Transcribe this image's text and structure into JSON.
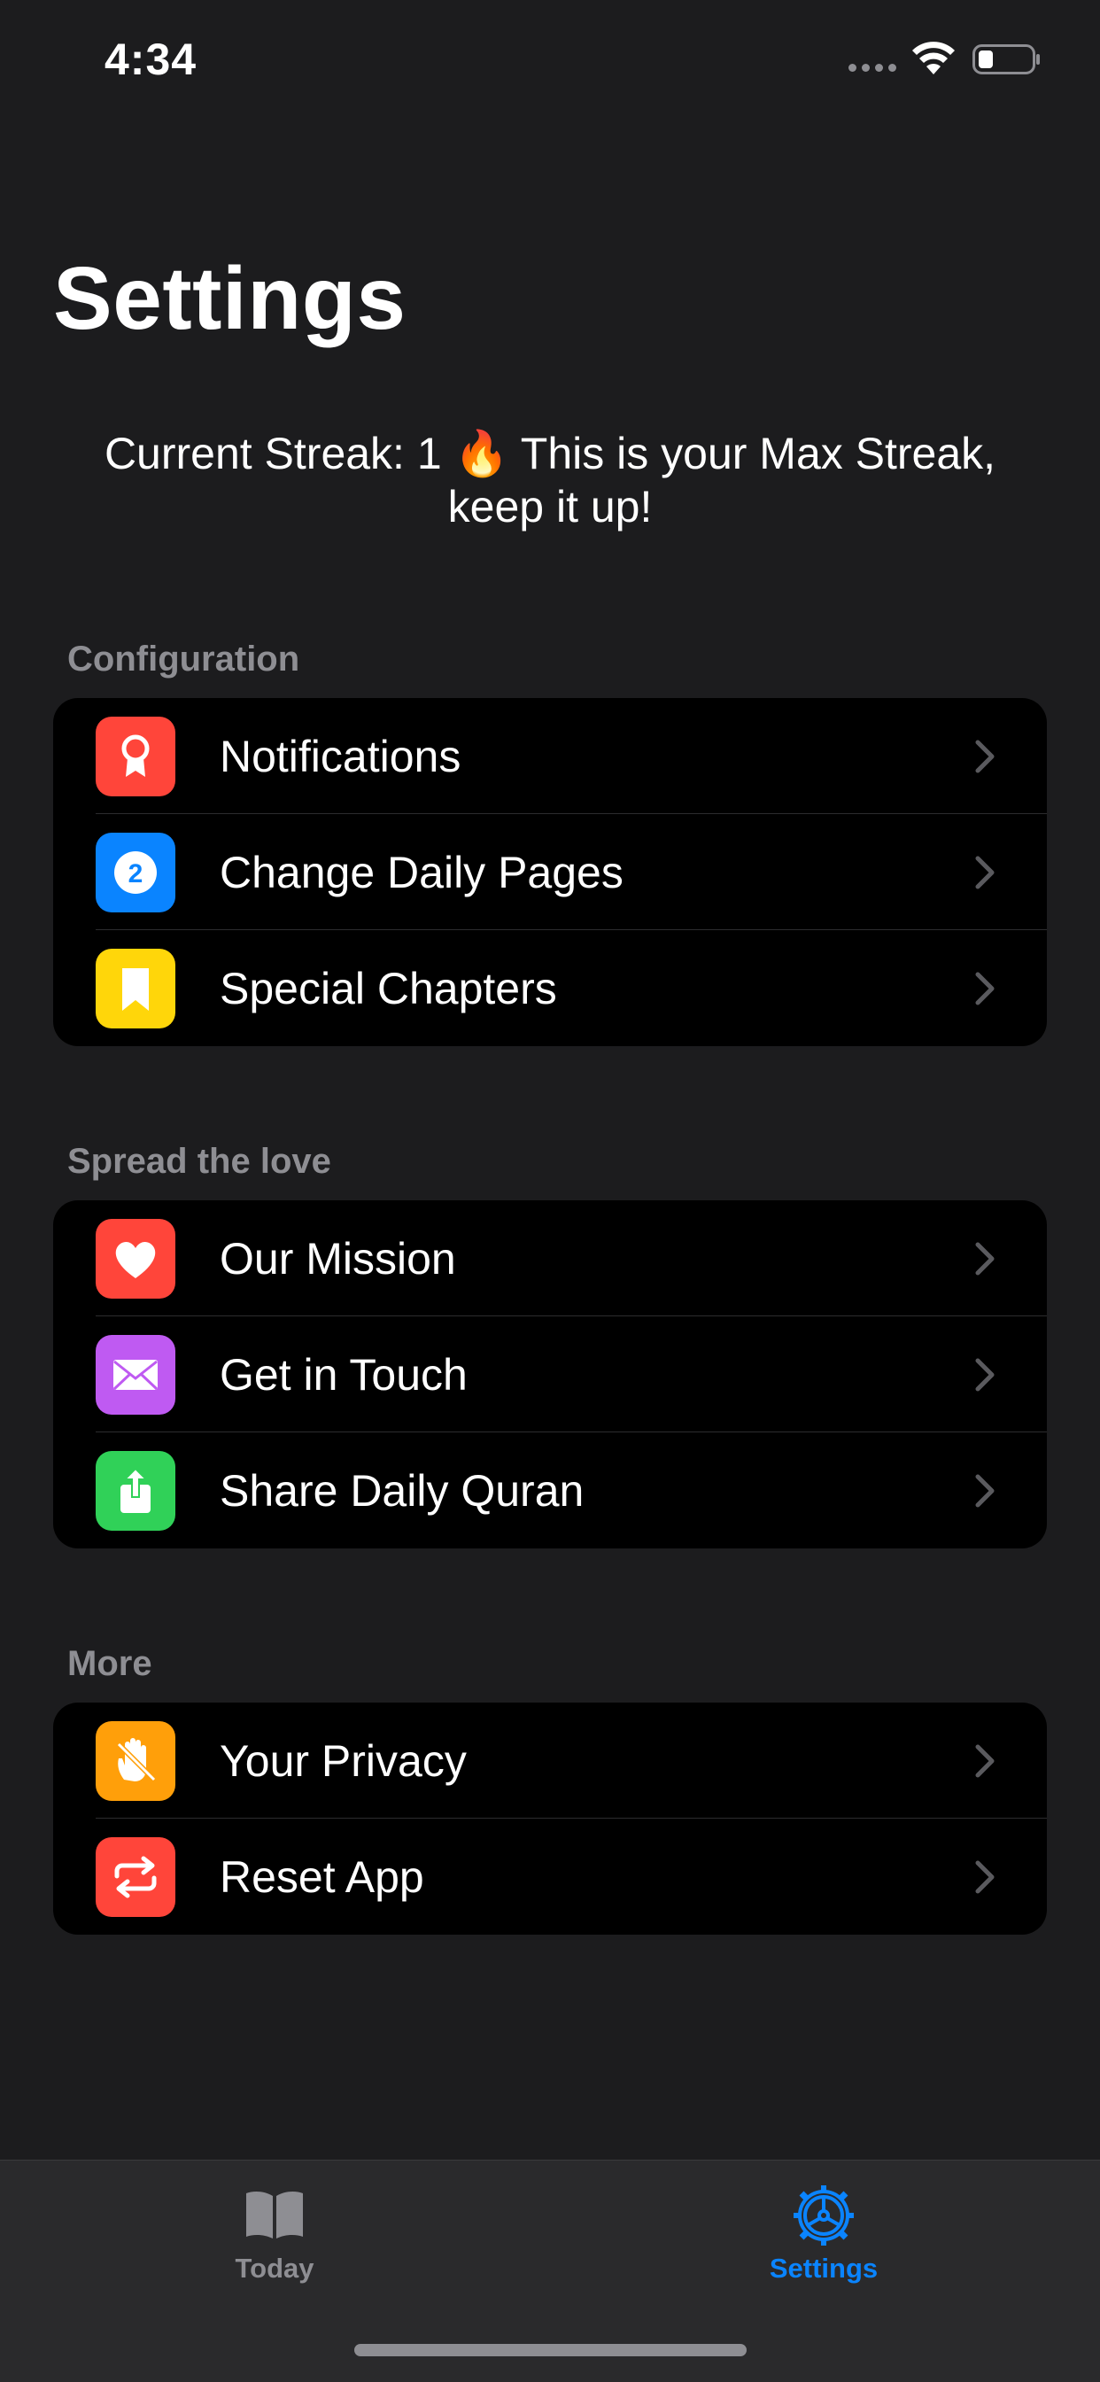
{
  "status_bar": {
    "time": "4:34"
  },
  "title": "Settings",
  "streak": {
    "text": "Current Streak: 1 🔥 This is your Max Streak, keep it up!"
  },
  "sections": [
    {
      "header": "Configuration",
      "items": [
        {
          "label": "Notifications",
          "icon": "ribbon-award-icon",
          "color": "#ff453a"
        },
        {
          "label": "Change Daily Pages",
          "icon": "number-2-circle-icon",
          "color": "#0a84ff"
        },
        {
          "label": "Special Chapters",
          "icon": "bookmark-icon",
          "color": "#ffd60a"
        }
      ]
    },
    {
      "header": "Spread the love",
      "items": [
        {
          "label": "Our Mission",
          "icon": "heart-icon",
          "color": "#ff453a"
        },
        {
          "label": "Get in Touch",
          "icon": "envelope-icon",
          "color": "#bf5af2"
        },
        {
          "label": "Share Daily Quran",
          "icon": "share-icon",
          "color": "#30d158"
        }
      ]
    },
    {
      "header": "More",
      "items": [
        {
          "label": "Your Privacy",
          "icon": "hand-raised-slash-icon",
          "color": "#ff9f0a"
        },
        {
          "label": "Reset App",
          "icon": "repeat-arrows-icon",
          "color": "#ff453a"
        }
      ]
    }
  ],
  "tabs": [
    {
      "label": "Today",
      "icon": "book-icon",
      "active": false,
      "color": "#8e8e93"
    },
    {
      "label": "Settings",
      "icon": "gear-icon",
      "active": true,
      "color": "#0a84ff"
    }
  ]
}
